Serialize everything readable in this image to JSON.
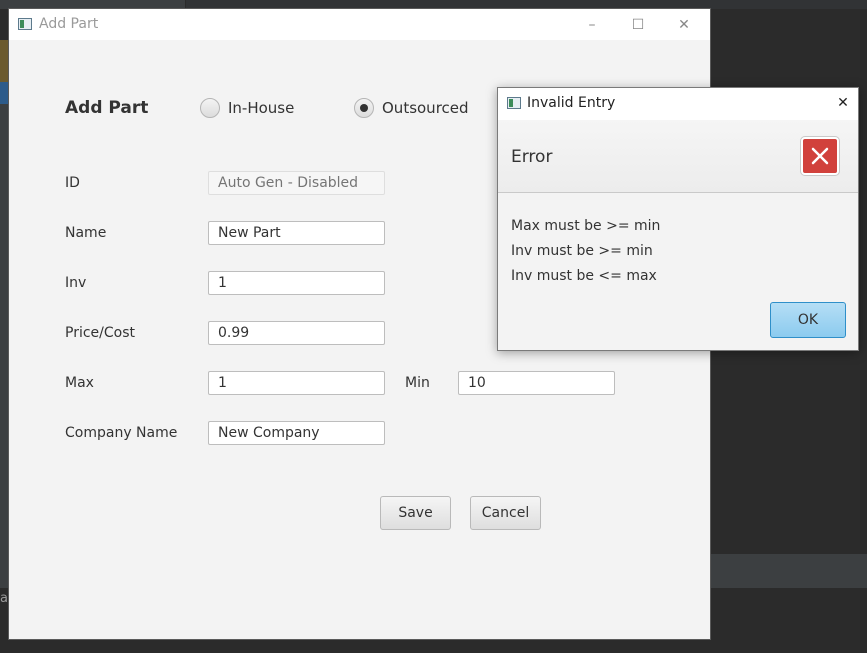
{
  "main_window": {
    "title": "Add Part",
    "controls": {
      "minimize": "–",
      "maximize": "☐",
      "close": "✕"
    }
  },
  "form": {
    "heading": "Add Part",
    "radio_options": [
      {
        "label": "In-House",
        "selected": false
      },
      {
        "label": "Outsourced",
        "selected": true
      }
    ],
    "fields": {
      "id": {
        "label": "ID",
        "value": "",
        "placeholder": "Auto Gen - Disabled"
      },
      "name": {
        "label": "Name",
        "value": "New Part"
      },
      "inv": {
        "label": "Inv",
        "value": "1"
      },
      "price": {
        "label": "Price/Cost",
        "value": "0.99"
      },
      "max": {
        "label": "Max",
        "value": "1"
      },
      "min": {
        "label": "Min",
        "value": "10"
      },
      "company": {
        "label": "Company Name",
        "value": "New Company"
      }
    },
    "buttons": {
      "save": "Save",
      "cancel": "Cancel"
    }
  },
  "dialog": {
    "title": "Invalid Entry",
    "close_glyph": "✕",
    "header": "Error",
    "icon": "error-x-icon",
    "messages": [
      "Max must be >= min",
      "Inv must be >= min",
      "Inv must be <= max"
    ],
    "ok_label": "OK"
  },
  "background": {
    "fragment_text": "a"
  },
  "colors": {
    "window_bg": "#f3f3f3",
    "error_red": "#d1413c",
    "ok_blue": "#8ccbef"
  }
}
